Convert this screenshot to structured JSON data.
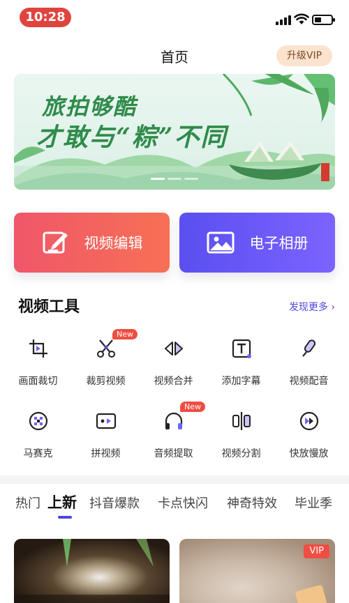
{
  "status_bar": {
    "time": "10:28"
  },
  "header": {
    "title": "首页",
    "vip_button": "升级VIP"
  },
  "banner": {
    "line1": "旅拍够酷",
    "line2": "才敢与“粽”不同",
    "dots": 3,
    "active_dot": 0
  },
  "actions": [
    {
      "label": "视频编辑",
      "icon": "edit-icon"
    },
    {
      "label": "电子相册",
      "icon": "photo-icon"
    }
  ],
  "tools_section": {
    "title": "视频工具",
    "more_link": "发现更多 ›",
    "tools": [
      {
        "label": "画面裁切",
        "icon": "crop-icon",
        "badge": ""
      },
      {
        "label": "裁剪视频",
        "icon": "scissors-icon",
        "badge": "New"
      },
      {
        "label": "视频合并",
        "icon": "merge-icon",
        "badge": ""
      },
      {
        "label": "添加字幕",
        "icon": "subtitle-icon",
        "badge": ""
      },
      {
        "label": "视频配音",
        "icon": "voiceover-icon",
        "badge": ""
      },
      {
        "label": "马赛克",
        "icon": "mosaic-icon",
        "badge": ""
      },
      {
        "label": "拼视频",
        "icon": "collage-icon",
        "badge": ""
      },
      {
        "label": "音频提取",
        "icon": "headphones-icon",
        "badge": "New"
      },
      {
        "label": "视频分割",
        "icon": "split-icon",
        "badge": ""
      },
      {
        "label": "快放慢放",
        "icon": "speed-icon",
        "badge": ""
      }
    ]
  },
  "category_tabs": [
    "热门",
    "上新",
    "抖音爆款",
    "卡点快闪",
    "神奇特效",
    "毕业季"
  ],
  "active_category": 1,
  "cards": [
    {
      "vip": ""
    },
    {
      "vip": "VIP"
    }
  ],
  "colors": {
    "accent": "#4c47e4",
    "red": "#f04d43",
    "edit_btn": "#f0566a",
    "album_btn": "#5b4ff0"
  }
}
